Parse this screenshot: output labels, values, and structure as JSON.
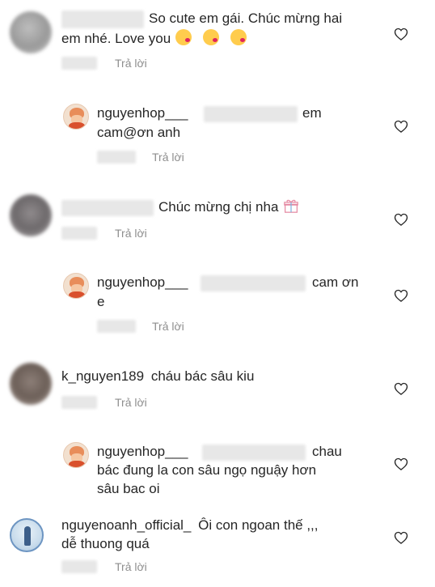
{
  "reply_label": "Trả lời",
  "comments": [
    {
      "username": "",
      "text_line1": "So cute em gái. Chúc mừng hai",
      "text_line2": "em nhé. Love you",
      "emojis": [
        "kissing-heart-emoji",
        "kissing-heart-emoji",
        "kissing-heart-emoji"
      ]
    },
    {
      "username": "nguyenhop___",
      "text_line1": "em",
      "text_line2": "cam@ơn anh"
    },
    {
      "username": "",
      "text_line1": "Chúc mừng chị nha",
      "emojis": [
        "gift-emoji"
      ]
    },
    {
      "username": "nguyenhop___",
      "text_line1": "cam ơn",
      "text_line2": "e"
    },
    {
      "username": "k_nguyen189",
      "text_line1": "cháu bác sâu kiu"
    },
    {
      "username": "nguyenhop___",
      "text_line1": "chau",
      "text_line2": "bác đung la con sâu ngọ nguậy hơn",
      "text_line3": "sâu bac oi"
    },
    {
      "username": "nguyenoanh_official_",
      "text_line1": "Ôi con ngoan thế ,,,",
      "text_line2": "dễ thuong quá"
    }
  ],
  "colors": {
    "text": "#262626",
    "secondary": "#8e8e8e",
    "redaction": "#e7e7e7"
  },
  "icons": {
    "like": "heart-outline-icon"
  }
}
